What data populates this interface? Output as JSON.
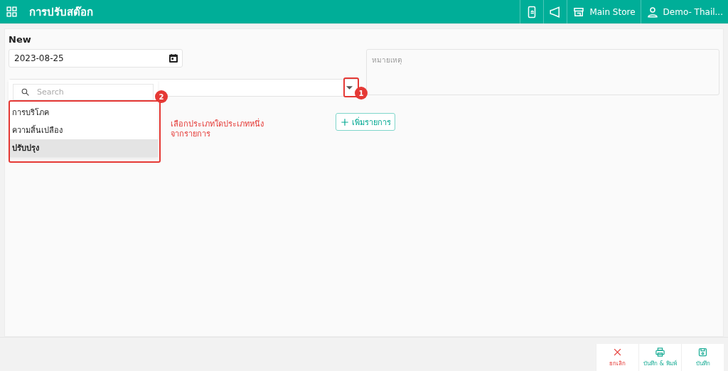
{
  "header": {
    "title": "การปรับสต๊อก",
    "actions": [
      {
        "kind": "phone"
      },
      {
        "kind": "megaphone"
      }
    ],
    "store": "Main Store",
    "user": "Demo- Thail..."
  },
  "form": {
    "heading": "New",
    "date": "2023-08-25",
    "note_placeholder": "หมายเหตุ",
    "add_button": "เพิ่มรายการ"
  },
  "dropdown": {
    "search_placeholder": "Search",
    "options": [
      {
        "label": "การบริโภค",
        "selected": false
      },
      {
        "label": "ความสิ้นเปลือง",
        "selected": false
      },
      {
        "label": "ปรับปรุง",
        "selected": true
      }
    ]
  },
  "annotations": [
    {
      "number": "1",
      "kind": "arrow"
    },
    {
      "number": "2",
      "kind": "list",
      "note": "เลือกประเภทใดประเภทหนึ่ง\nจากรายการ"
    }
  ],
  "footer": {
    "buttons": [
      {
        "kind": "cancel",
        "label": "ยกเลิก"
      },
      {
        "kind": "print",
        "label": "บันทึก & พิมพ์"
      },
      {
        "kind": "save",
        "label": "บันทึก"
      }
    ]
  }
}
